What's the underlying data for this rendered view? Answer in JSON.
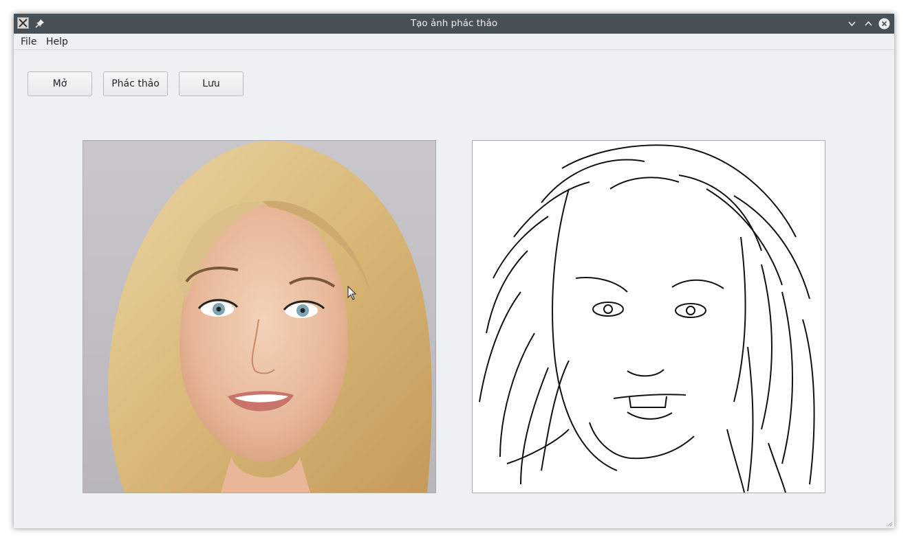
{
  "window": {
    "title": "Tạo ảnh phác thảo",
    "app_icon": "x11-icon",
    "pin_icon": "pin-icon",
    "controls": [
      "minimize-icon",
      "maximize-icon",
      "close-icon"
    ]
  },
  "menubar": {
    "items": [
      {
        "label": "File"
      },
      {
        "label": "Help"
      }
    ]
  },
  "toolbar": {
    "open_label": "Mở",
    "sketch_label": "Phác thảo",
    "save_label": "Lưu"
  },
  "images": {
    "original": "portrait-photo",
    "sketch": "line-sketch"
  },
  "colors": {
    "titlebar": "#475057",
    "window_bg": "#eff0f1",
    "title_text": "#eff0f1"
  }
}
